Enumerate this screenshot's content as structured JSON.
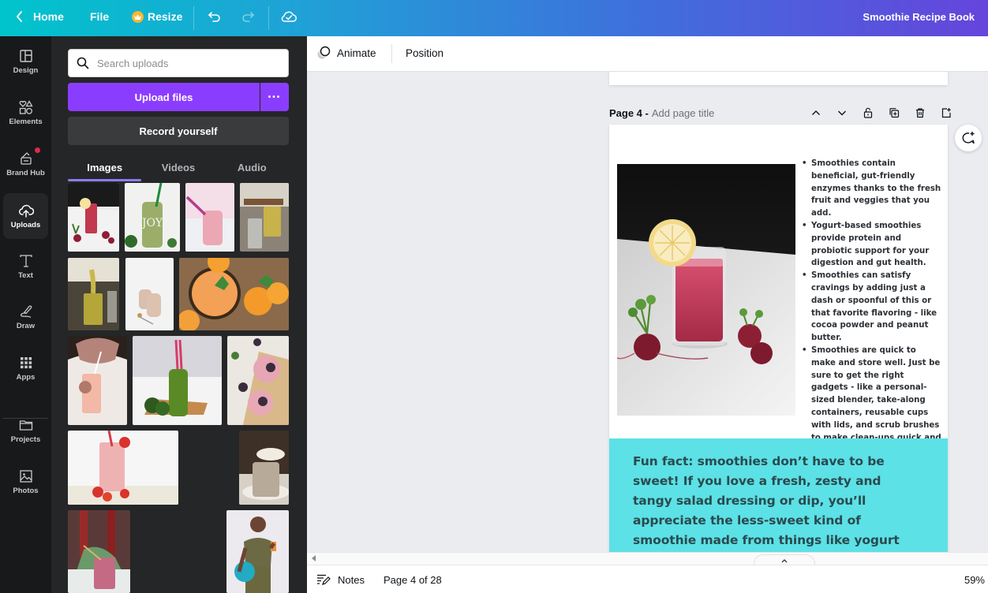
{
  "topbar": {
    "home_label": "Home",
    "file_label": "File",
    "resize_label": "Resize",
    "document_title": "Smoothie Recipe Book"
  },
  "rail": {
    "items": [
      {
        "label": "Design",
        "icon": "layout-icon"
      },
      {
        "label": "Elements",
        "icon": "shapes-icon"
      },
      {
        "label": "Brand Hub",
        "icon": "brand-hub-icon",
        "notification": true
      },
      {
        "label": "Uploads",
        "icon": "cloud-upload-icon",
        "active": true
      },
      {
        "label": "Text",
        "icon": "text-icon"
      },
      {
        "label": "Draw",
        "icon": "draw-icon"
      },
      {
        "label": "Apps",
        "icon": "apps-grid-icon"
      },
      {
        "label": "Projects",
        "icon": "folder-icon"
      },
      {
        "label": "Photos",
        "icon": "image-icon"
      }
    ]
  },
  "panel": {
    "search_placeholder": "Search uploads",
    "upload_label": "Upload files",
    "more_label": "•••",
    "record_label": "Record yourself",
    "tabs": [
      {
        "label": "Images",
        "active": true
      },
      {
        "label": "Videos"
      },
      {
        "label": "Audio"
      }
    ],
    "thumbnails": [
      "Red beet smoothie with lemon slice",
      "Green smoothie in JOY jar",
      "Pink smoothie with purple straw",
      "Yellow smoothie in pitcher and glasses",
      "Pouring yellow smoothie into glass",
      "Two tan smoothies with spoon",
      "Orange juice with mint and oranges",
      "Woman drinking pink smoothie",
      "Green smoothie bottle with kale",
      "Blackberry smoothies with mint",
      "Strawberry smoothie with striped straw",
      "Coconut smoothie on plate",
      "Berry smoothie in mason jar",
      "Woman with exercise ball holding juice"
    ]
  },
  "editor_toolbar": {
    "animate_label": "Animate",
    "position_label": "Position"
  },
  "canvas": {
    "page_number_label": "Page 4 -",
    "page_title_placeholder": "Add page title",
    "photo_alt": "Beet smoothie with lemon slice and radishes",
    "bullets": [
      "Smoothies contain beneficial, gut-friendly enzymes thanks to the fresh fruit and veggies that you add.",
      "Yogurt-based smoothies provide protein and probiotic support for your digestion and gut health.",
      "Smoothies can satisfy cravings by adding just a dash or spoonful of this or that favorite flavoring - like cocoa powder and peanut butter.",
      "Smoothies are quick to make and store well. Just be sure to get the right gadgets - like a personal-sized blender, take-along containers, reusable cups with lids, and scrub brushes to make clean-ups quick and painless."
    ],
    "fun_fact": "Fun fact: smoothies don’t have to be sweet! If you love a fresh, zesty and tangy salad dressing or dip, you’ll appreciate the less-sweet kind of smoothie made from things like yogurt and cucumber.",
    "fun_fact_bg": "#5ce1e6"
  },
  "bottombar": {
    "notes_label": "Notes",
    "page_indicator": "Page 4 of 28",
    "zoom_level": "59%"
  },
  "colors": {
    "brand_purple": "#8b3dff",
    "panel_bg": "#252627",
    "rail_bg": "#18191b"
  }
}
